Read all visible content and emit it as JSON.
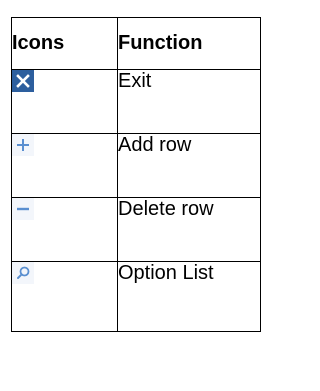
{
  "table": {
    "headers": {
      "icons": "Icons",
      "function": "Function"
    },
    "rows": [
      {
        "icon": "close-icon",
        "function": "Exit"
      },
      {
        "icon": "plus-icon",
        "function": "Add row"
      },
      {
        "icon": "minus-icon",
        "function": "Delete row"
      },
      {
        "icon": "search-icon",
        "function": "Option List"
      }
    ]
  },
  "colors": {
    "exit_icon_bg": "#2d5f9e",
    "light_icon": "#5a8fd0"
  }
}
